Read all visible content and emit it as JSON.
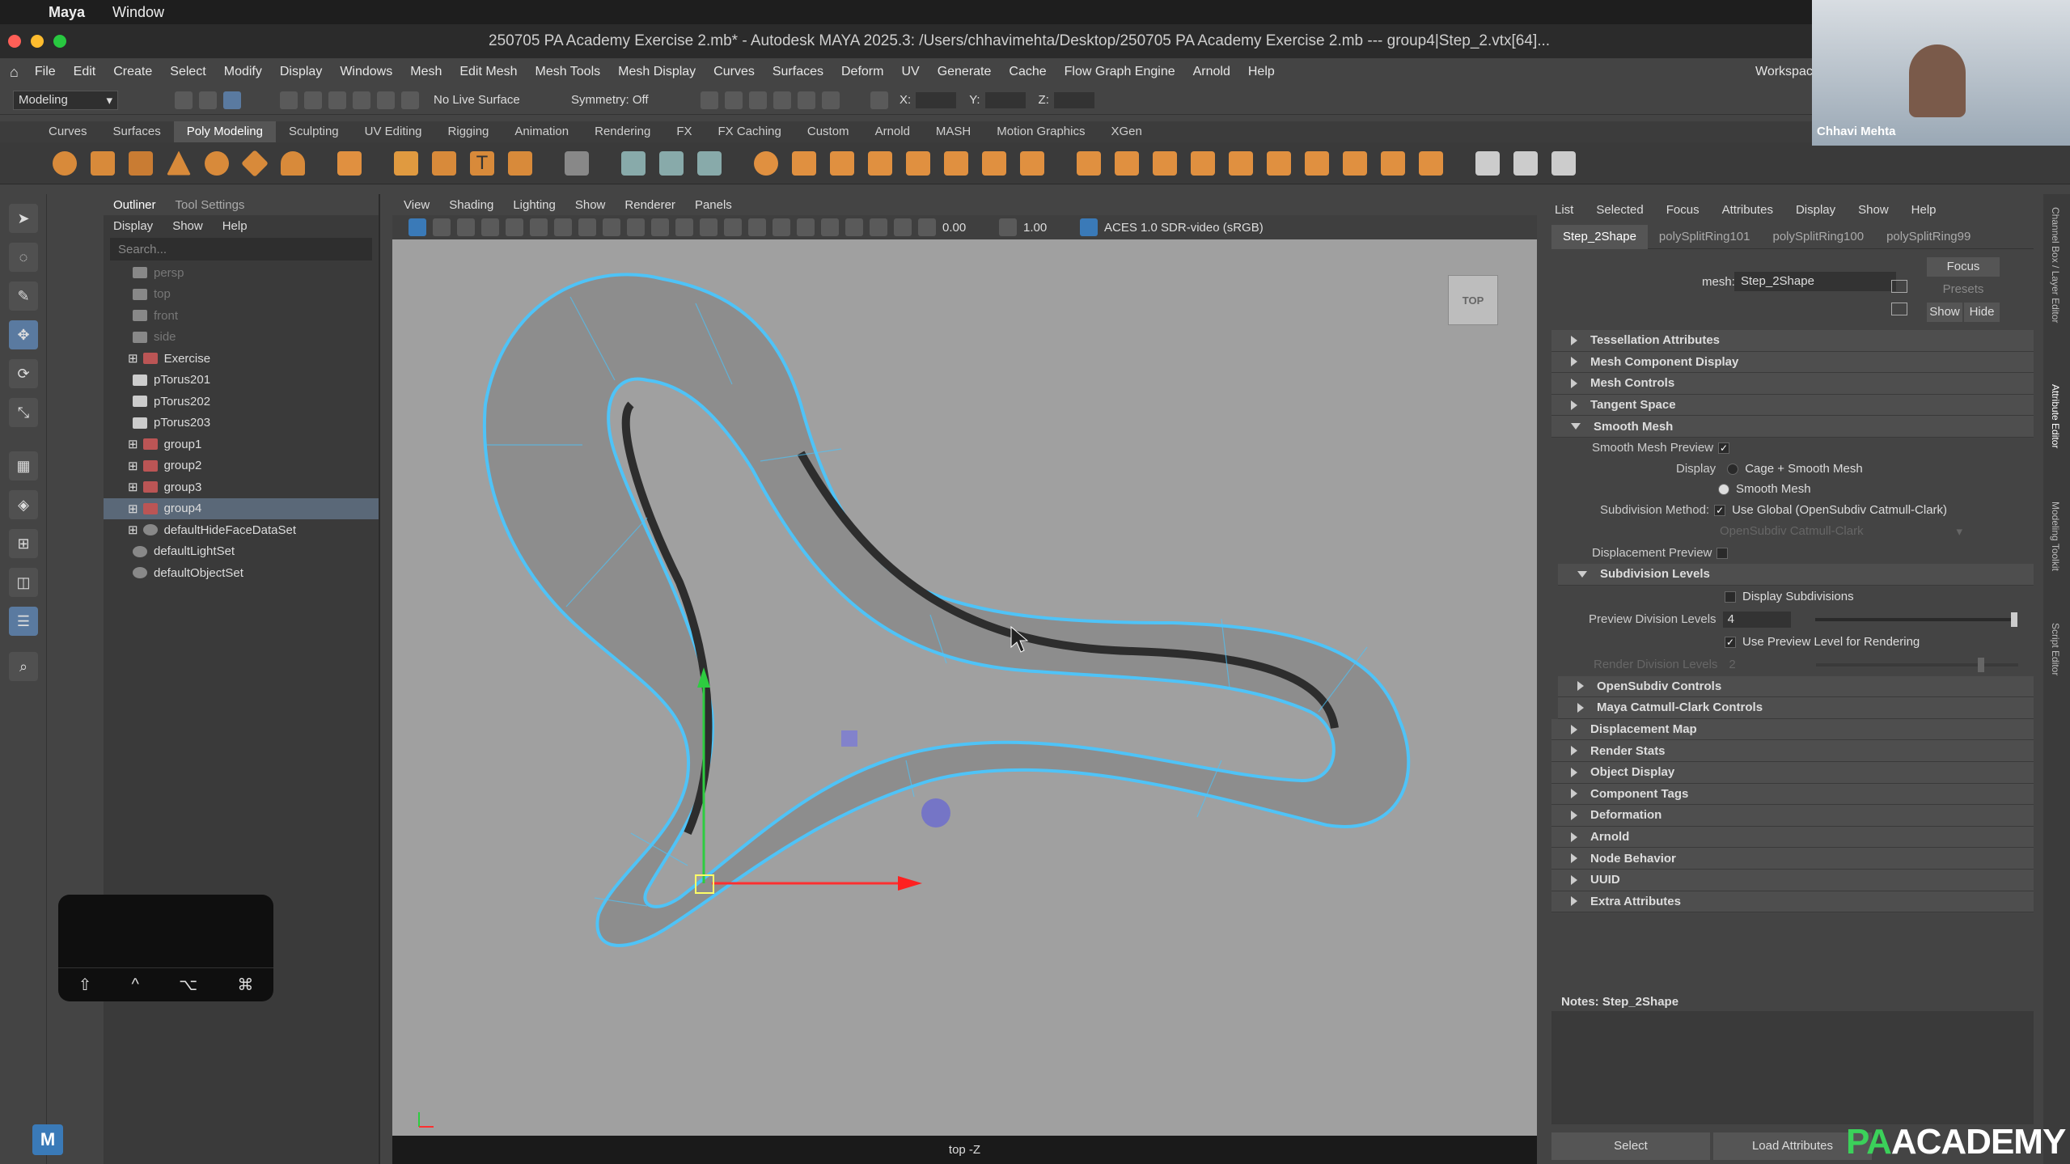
{
  "mac": {
    "app": "Maya",
    "menu": "Window"
  },
  "window": {
    "title": "250705 PA Academy Exercise 2.mb* - Autodesk MAYA 2025.3: /Users/chhavimehta/Desktop/250705 PA Academy Exercise 2.mb  ---  group4|Step_2.vtx[64]..."
  },
  "menus": [
    "File",
    "Edit",
    "Create",
    "Select",
    "Modify",
    "Display",
    "Windows",
    "Mesh",
    "Edit Mesh",
    "Mesh Tools",
    "Mesh Display",
    "Curves",
    "Surfaces",
    "Deform",
    "UV",
    "Generate",
    "Cache",
    "Flow Graph Engine",
    "Arnold",
    "Help"
  ],
  "workspace_label": "Workspac",
  "status": {
    "mode": "Modeling",
    "live_surface": "No Live Surface",
    "symmetry": "Symmetry: Off",
    "x": "X:",
    "y": "Y:",
    "z": "Z:"
  },
  "shelf_tabs": [
    "Curves",
    "Surfaces",
    "Poly Modeling",
    "Sculpting",
    "UV Editing",
    "Rigging",
    "Animation",
    "Rendering",
    "FX",
    "FX Caching",
    "Custom",
    "Arnold",
    "MASH",
    "Motion Graphics",
    "XGen"
  ],
  "outliner": {
    "tabs": [
      "Outliner",
      "Tool Settings"
    ],
    "menu": [
      "Display",
      "Show",
      "Help"
    ],
    "search_placeholder": "Search...",
    "items": [
      "persp",
      "top",
      "front",
      "side",
      "Exercise",
      "pTorus201",
      "pTorus202",
      "pTorus203",
      "group1",
      "group2",
      "group3",
      "group4",
      "defaultHideFaceDataSet",
      "defaultLightSet",
      "defaultObjectSet"
    ]
  },
  "keypad": [
    "⇧",
    "^",
    "⌥",
    "⌘"
  ],
  "viewport": {
    "menu": [
      "View",
      "Shading",
      "Lighting",
      "Show",
      "Renderer",
      "Panels"
    ],
    "exposure": "0.00",
    "gamma": "1.00",
    "colorspace": "ACES 1.0 SDR-video (sRGB)",
    "view_cube": "TOP",
    "camera_label": "top -Z"
  },
  "ae": {
    "menu": [
      "List",
      "Selected",
      "Focus",
      "Attributes",
      "Display",
      "Show",
      "Help"
    ],
    "tabs": [
      "Step_2Shape",
      "polySplitRing101",
      "polySplitRing100",
      "polySplitRing99"
    ],
    "mesh_label": "mesh:",
    "mesh_value": "Step_2Shape",
    "buttons": {
      "focus": "Focus",
      "presets": "Presets",
      "show": "Show",
      "hide": "Hide"
    },
    "sections_top": [
      "Tessellation Attributes",
      "Mesh Component Display",
      "Mesh Controls",
      "Tangent Space"
    ],
    "smooth_mesh": "Smooth Mesh",
    "smooth_preview": "Smooth Mesh Preview",
    "display_label": "Display",
    "display_opts": [
      "Cage + Smooth Mesh",
      "Smooth Mesh"
    ],
    "subdiv_method_label": "Subdivision Method:",
    "subdiv_method_val": "Use Global (OpenSubdiv Catmull-Clark)",
    "subdiv_dropdown": "OpenSubdiv Catmull-Clark",
    "displacement_preview": "Displacement Preview",
    "subdiv_levels": "Subdivision Levels",
    "display_subdivisions": "Display Subdivisions",
    "preview_div_label": "Preview Division Levels",
    "preview_div_val": "4",
    "use_preview": "Use Preview Level for Rendering",
    "render_div_label": "Render Division Levels",
    "render_div_val": "2",
    "sections_sub": [
      "OpenSubdiv Controls",
      "Maya Catmull-Clark Controls"
    ],
    "sections_bottom": [
      "Displacement Map",
      "Render Stats",
      "Object Display",
      "Component Tags",
      "Deformation",
      "Arnold",
      "Node Behavior",
      "UUID",
      "Extra Attributes"
    ],
    "notes": "Notes:  Step_2Shape",
    "footer": {
      "select": "Select",
      "load": "Load Attributes"
    }
  },
  "webcam_name": "Chhavi Mehta",
  "logo": "PAACADEMY",
  "right_strip": [
    "Channel Box / Layer Editor",
    "Attribute Editor",
    "Modeling Toolkit",
    "Script Editor"
  ]
}
